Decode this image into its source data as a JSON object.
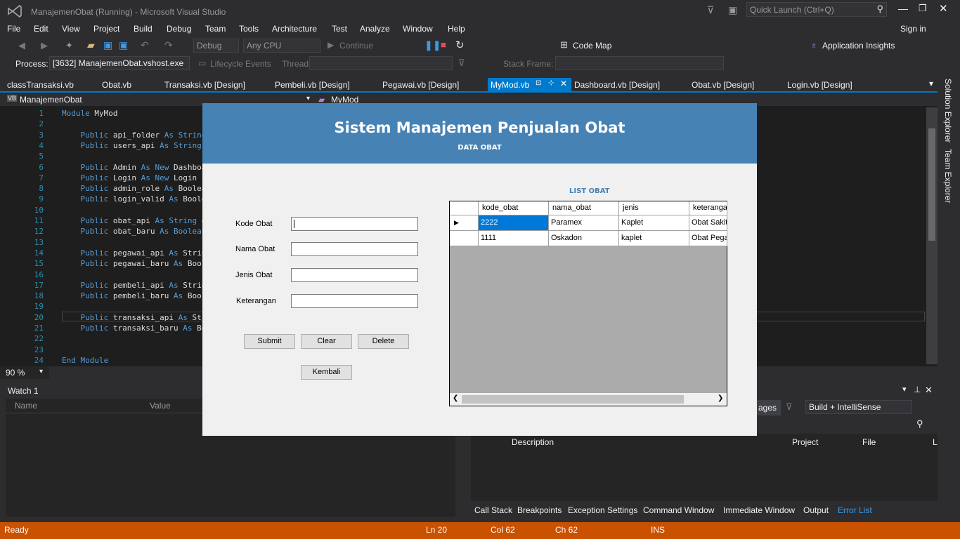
{
  "window": {
    "title": "ManajemenObat (Running) - Microsoft Visual Studio",
    "quick_launch": "Quick Launch (Ctrl+Q)",
    "sign_in": "Sign in"
  },
  "menu": [
    "File",
    "Edit",
    "View",
    "Project",
    "Build",
    "Debug",
    "Team",
    "Tools",
    "Architecture",
    "Test",
    "Analyze",
    "Window",
    "Help"
  ],
  "toolbar": {
    "config": "Debug",
    "platform": "Any CPU",
    "continue": "Continue",
    "code_map": "Code Map",
    "app_insights": "Application Insights"
  },
  "debugbar": {
    "process_label": "Process:",
    "process_value": "[3632] ManajemenObat.vshost.exe",
    "lifecycle": "Lifecycle Events",
    "thread_label": "Thread:",
    "stack_frame_label": "Stack Frame:"
  },
  "tabs": [
    "classTransaksi.vb",
    "Obat.vb",
    "Transaksi.vb [Design]",
    "Pembeli.vb [Design]",
    "Pegawai.vb [Design]",
    "MyMod.vb",
    "Dashboard.vb [Design]",
    "Obat.vb [Design]",
    "Login.vb [Design]"
  ],
  "nav": {
    "project": "ManajemenObat",
    "module": "MyMod"
  },
  "code": {
    "line_numbers": [
      "1",
      "2",
      "3",
      "4",
      "5",
      "6",
      "7",
      "8",
      "9",
      "10",
      "11",
      "12",
      "13",
      "14",
      "15",
      "16",
      "17",
      "18",
      "19",
      "20",
      "21",
      "22",
      "23",
      "24"
    ],
    "lines": [
      "Module MyMod",
      "",
      "    Public api_folder As String",
      "    Public users_api As String",
      "",
      "    Public Admin As New Dashboa",
      "    Public Login As New Login",
      "    Public admin_role As Boolea",
      "    Public login_valid As Boole",
      "",
      "    Public obat_api As String =",
      "    Public obat_baru As Boolean",
      "",
      "    Public pegawai_api As Strin",
      "    Public pegawai_baru As Bool",
      "",
      "    Public pembeli_api As Strin",
      "    Public pembeli_baru As Bool",
      "",
      "    Public transaksi_api As Str",
      "    Public transaksi_baru As Bo",
      "",
      "",
      "End Module"
    ]
  },
  "zoom": "90 %",
  "watch": {
    "title": "Watch 1",
    "col_name": "Name",
    "col_value": "Value"
  },
  "errorlist": {
    "messages_btn": "ages",
    "build_filter": "Build + IntelliSense",
    "col_desc": "Description",
    "col_project": "Project",
    "col_file": "File",
    "col_l": "L"
  },
  "bottom_tabs": [
    "Call Stack",
    "Breakpoints",
    "Exception Settings",
    "Command Window",
    "Immediate Window",
    "Output",
    "Error List"
  ],
  "side": {
    "solution_explorer": "Solution Explorer",
    "team_explorer": "Team Explorer"
  },
  "status": {
    "ready": "Ready",
    "ln": "Ln 20",
    "col": "Col 62",
    "ch": "Ch 62",
    "ins": "INS"
  },
  "dialog": {
    "title": "Sistem Manajemen Penjualan Obat",
    "subtitle": "DATA OBAT",
    "list_title": "LIST OBAT",
    "labels": {
      "kode": "Kode Obat",
      "nama": "Nama Obat",
      "jenis": "Jenis Obat",
      "keterangan": "Keterangan"
    },
    "buttons": {
      "submit": "Submit",
      "clear": "Clear",
      "delete": "Delete",
      "kembali": "Kembali"
    },
    "grid": {
      "columns": [
        "kode_obat",
        "nama_obat",
        "jenis",
        "keteranga"
      ],
      "rows": [
        [
          "2222",
          "Paramex",
          "Kaplet",
          "Obat Sakit"
        ],
        [
          "1111",
          "Oskadon",
          "kaplet",
          "Obat Pega"
        ]
      ]
    }
  },
  "colors": {
    "accent": "#007acc",
    "status": "#ca5100",
    "dialog_header": "#4682b4"
  }
}
